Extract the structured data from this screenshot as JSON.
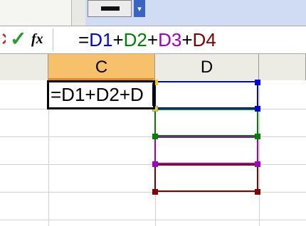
{
  "formula_bar": {
    "cancel_symbol": "✕",
    "enter_symbol": "✓",
    "fx_symbol": "fx",
    "formula_parts": [
      {
        "text": "=",
        "color": "#000000"
      },
      {
        "text": "D1",
        "color": "#0000e0"
      },
      {
        "text": "+",
        "color": "#000000"
      },
      {
        "text": "D2",
        "color": "#008000"
      },
      {
        "text": "+",
        "color": "#000000"
      },
      {
        "text": "D3",
        "color": "#a000c0"
      },
      {
        "text": "+",
        "color": "#000000"
      },
      {
        "text": "D4",
        "color": "#800000"
      }
    ]
  },
  "columns": {
    "c": "C",
    "d": "D"
  },
  "active_cell": {
    "text": "=D1+D2+D"
  },
  "ref_colors": {
    "d1": "#0000e0",
    "d2": "#008000",
    "d3": "#a000c0",
    "d4": "#800000"
  },
  "toolbar": {
    "dropdown_symbol": "▾"
  }
}
